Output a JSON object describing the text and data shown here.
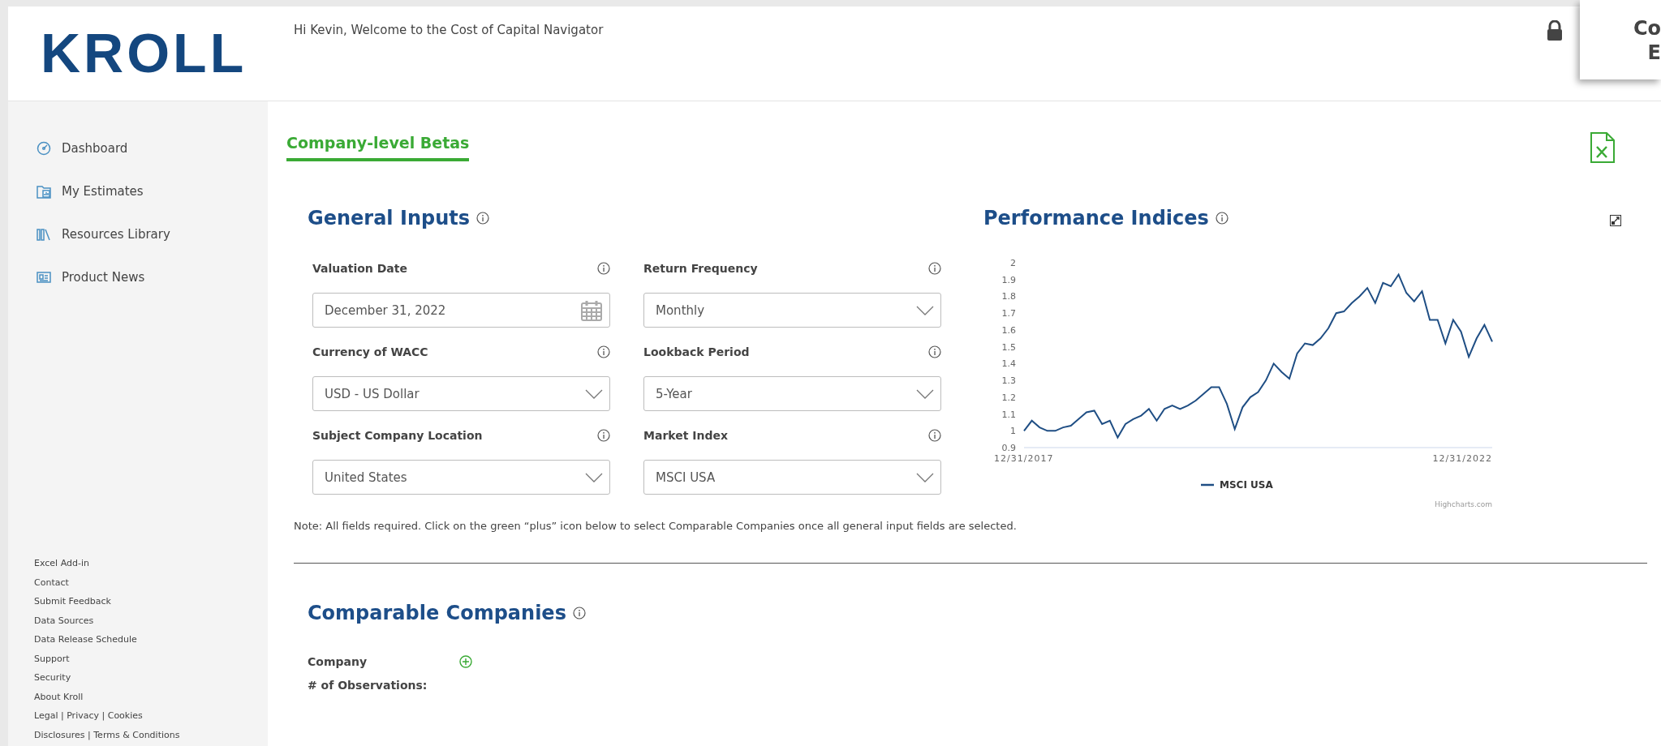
{
  "header": {
    "logo": "KROLL",
    "greeting": "Hi Kevin, Welcome to the Cost of Capital Navigator",
    "popup_lines": [
      "Co",
      "E"
    ]
  },
  "sidebar": {
    "items": [
      {
        "label": "Dashboard"
      },
      {
        "label": "My Estimates"
      },
      {
        "label": "Resources Library"
      },
      {
        "label": "Product News"
      }
    ],
    "footer_links": [
      "Excel Add-in",
      "Contact",
      "Submit Feedback",
      "Data Sources",
      "Data Release Schedule",
      "Support",
      "Security",
      "About Kroll",
      "Legal | Privacy | Cookies",
      "Disclosures | Terms & Conditions"
    ]
  },
  "tabs": [
    {
      "label": "Company-level Betas",
      "selected": true
    }
  ],
  "general_inputs": {
    "title": "General Inputs",
    "fields": [
      {
        "label": "Valuation Date",
        "value": "December 31, 2022",
        "kind": "date"
      },
      {
        "label": "Return Frequency",
        "value": "Monthly",
        "kind": "select"
      },
      {
        "label": "Currency of WACC",
        "value": "USD - US Dollar",
        "kind": "select"
      },
      {
        "label": "Lookback Period",
        "value": "5-Year",
        "kind": "select"
      },
      {
        "label": "Subject Company Location",
        "value": "United States",
        "kind": "select"
      },
      {
        "label": "Market Index",
        "value": "MSCI USA",
        "kind": "select"
      }
    ]
  },
  "performance_indices": {
    "title": "Performance Indices",
    "x_axis_labels": [
      "12/31/2017",
      "12/31/2022"
    ],
    "credit": "Highcharts.com",
    "chart_data": {
      "type": "line",
      "ylim": [
        0.9,
        2
      ],
      "yticks": [
        0.9,
        1,
        1.1,
        1.2,
        1.3,
        1.4,
        1.5,
        1.6,
        1.7,
        1.8,
        1.9,
        2
      ],
      "series": [
        {
          "name": "MSCI USA",
          "color": "#1f4e84",
          "values": [
            1.0,
            1.06,
            1.02,
            1.0,
            1.0,
            1.02,
            1.03,
            1.07,
            1.11,
            1.12,
            1.04,
            1.06,
            0.96,
            1.04,
            1.07,
            1.09,
            1.13,
            1.06,
            1.13,
            1.15,
            1.13,
            1.15,
            1.18,
            1.22,
            1.26,
            1.26,
            1.16,
            1.01,
            1.14,
            1.2,
            1.23,
            1.3,
            1.4,
            1.35,
            1.31,
            1.46,
            1.52,
            1.51,
            1.55,
            1.61,
            1.7,
            1.71,
            1.76,
            1.8,
            1.85,
            1.76,
            1.88,
            1.86,
            1.93,
            1.82,
            1.77,
            1.83,
            1.66,
            1.66,
            1.52,
            1.66,
            1.59,
            1.44,
            1.55,
            1.63,
            1.53
          ]
        }
      ]
    }
  },
  "note": "Note: All fields required. Click on the green “plus” icon below to select Comparable Companies once all general input fields are selected.",
  "comparable_companies": {
    "title": "Comparable Companies",
    "fields": [
      "Company",
      "# of Observations:"
    ]
  }
}
